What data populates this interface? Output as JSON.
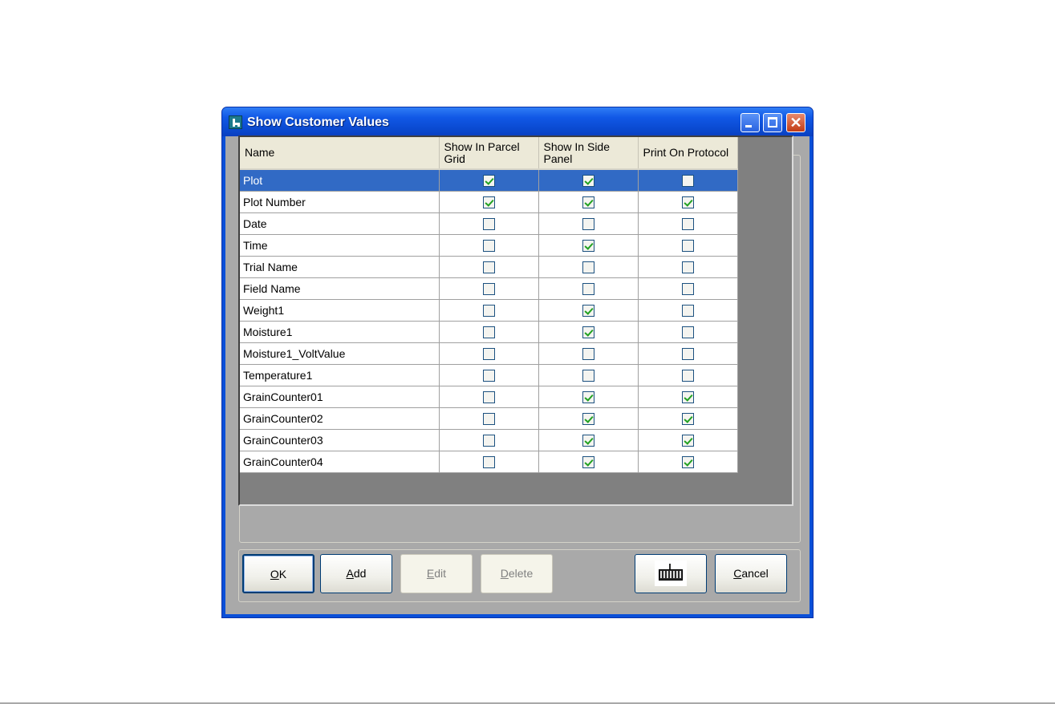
{
  "window": {
    "title": "Show Customer Values",
    "close_glyph": "✕"
  },
  "grid": {
    "columns": [
      "Name",
      "Show In Parcel Grid",
      "Show In Side Panel",
      "Print On Protocol"
    ],
    "rows": [
      {
        "name": "Plot",
        "parcel_grid": true,
        "side_panel": true,
        "protocol": false,
        "selected": true
      },
      {
        "name": "Plot Number",
        "parcel_grid": true,
        "side_panel": true,
        "protocol": true,
        "selected": false
      },
      {
        "name": "Date",
        "parcel_grid": false,
        "side_panel": false,
        "protocol": false,
        "selected": false
      },
      {
        "name": "Time",
        "parcel_grid": false,
        "side_panel": true,
        "protocol": false,
        "selected": false
      },
      {
        "name": "Trial Name",
        "parcel_grid": false,
        "side_panel": false,
        "protocol": false,
        "selected": false
      },
      {
        "name": "Field Name",
        "parcel_grid": false,
        "side_panel": false,
        "protocol": false,
        "selected": false
      },
      {
        "name": "Weight1",
        "parcel_grid": false,
        "side_panel": true,
        "protocol": false,
        "selected": false
      },
      {
        "name": "Moisture1",
        "parcel_grid": false,
        "side_panel": true,
        "protocol": false,
        "selected": false
      },
      {
        "name": "Moisture1_VoltValue",
        "parcel_grid": false,
        "side_panel": false,
        "protocol": false,
        "selected": false
      },
      {
        "name": "Temperature1",
        "parcel_grid": false,
        "side_panel": false,
        "protocol": false,
        "selected": false
      },
      {
        "name": "GrainCounter01",
        "parcel_grid": false,
        "side_panel": true,
        "protocol": true,
        "selected": false
      },
      {
        "name": "GrainCounter02",
        "parcel_grid": false,
        "side_panel": true,
        "protocol": true,
        "selected": false
      },
      {
        "name": "GrainCounter03",
        "parcel_grid": false,
        "side_panel": true,
        "protocol": true,
        "selected": false
      },
      {
        "name": "GrainCounter04",
        "parcel_grid": false,
        "side_panel": true,
        "protocol": true,
        "selected": false
      }
    ]
  },
  "buttons": {
    "ok": {
      "mnemonic": "O",
      "rest": "K"
    },
    "add": {
      "mnemonic": "A",
      "rest": "dd"
    },
    "edit": {
      "mnemonic": "E",
      "rest": "dit"
    },
    "delete": {
      "mnemonic": "D",
      "rest": "elete"
    },
    "cancel": {
      "mnemonic": "C",
      "rest": "ancel"
    },
    "keyboard_icon": "keyboard-icon"
  },
  "colors": {
    "titlebar": "#0a4ad0",
    "selection": "#316ac5",
    "check": "#21a121",
    "client": "#a9a9a9"
  }
}
